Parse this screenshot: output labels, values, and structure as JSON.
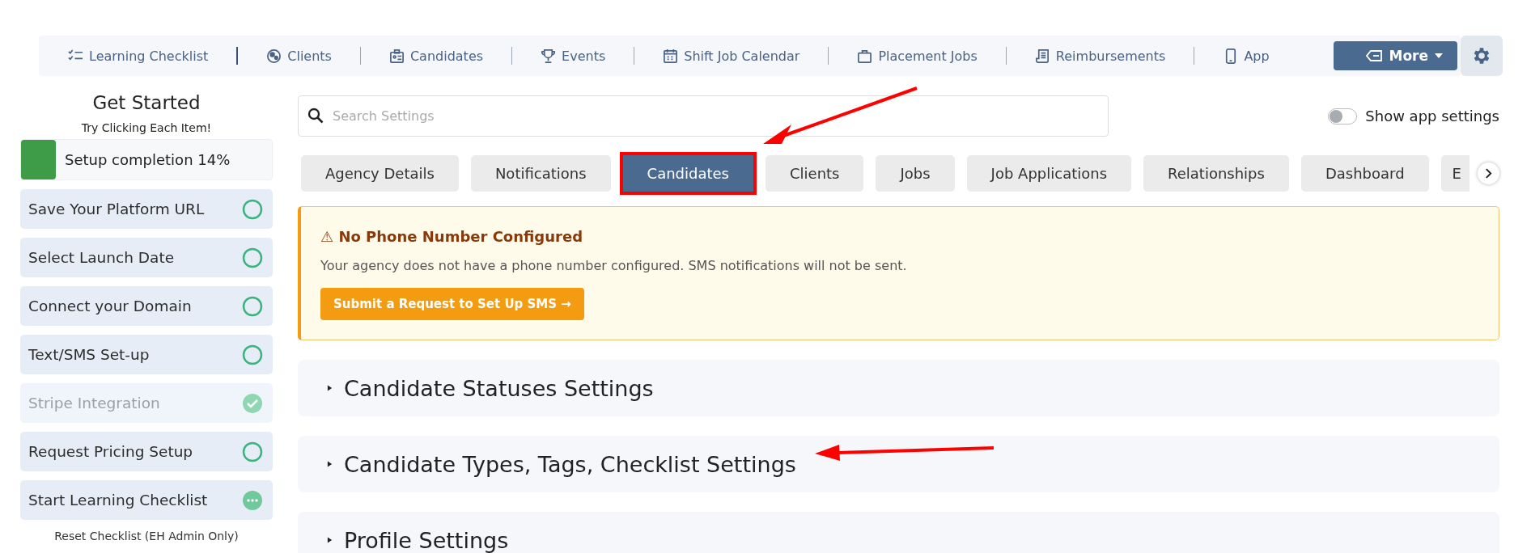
{
  "nav": {
    "items": [
      {
        "label": "Learning Checklist"
      },
      {
        "label": "Clients"
      },
      {
        "label": "Candidates"
      },
      {
        "label": "Events"
      },
      {
        "label": "Shift Job Calendar"
      },
      {
        "label": "Placement Jobs"
      },
      {
        "label": "Reimbursements"
      },
      {
        "label": "App"
      }
    ],
    "more_button": "More"
  },
  "sidebar": {
    "title": "Get Started",
    "subtitle": "Try Clicking Each Item!",
    "progress": {
      "label": "Setup completion 14%",
      "level": 0.14
    },
    "items": [
      {
        "label": "Save Your Platform URL",
        "kind": "todo"
      },
      {
        "label": "Select Launch Date",
        "kind": "todo"
      },
      {
        "label": "Connect your Domain",
        "kind": "todo"
      },
      {
        "label": "Text/SMS Set-up",
        "kind": "todo"
      },
      {
        "label": "Stripe Integration",
        "kind": "done"
      },
      {
        "label": "Request Pricing Setup",
        "kind": "todo"
      },
      {
        "label": "Start Learning Checklist",
        "kind": "in_progress"
      }
    ],
    "reset_link": "Reset Checklist (EH Admin Only)"
  },
  "search": {
    "placeholder": "Search Settings"
  },
  "app_settings_toggle": {
    "label": "Show app settings",
    "on": false
  },
  "tabs": [
    {
      "label": "Agency Details",
      "selected": false
    },
    {
      "label": "Notifications",
      "selected": false
    },
    {
      "label": "Candidates",
      "selected": true
    },
    {
      "label": "Clients",
      "selected": false
    },
    {
      "label": "Jobs",
      "selected": false
    },
    {
      "label": "Job Applications",
      "selected": false
    },
    {
      "label": "Relationships",
      "selected": false
    },
    {
      "label": "Dashboard",
      "selected": false
    },
    {
      "label": "E",
      "selected": false
    }
  ],
  "alert": {
    "icon": "⚠",
    "title": "No Phone Number Configured",
    "message": "Your agency does not have a phone number configured. SMS notifications will not be sent.",
    "button": "Submit a Request to Set Up SMS →"
  },
  "sections": [
    {
      "title": "Candidate Statuses Settings",
      "expanded": false
    },
    {
      "title": "Candidate Types, Tags, Checklist Settings",
      "expanded": false
    },
    {
      "title": "Profile Settings",
      "expanded": false
    }
  ]
}
